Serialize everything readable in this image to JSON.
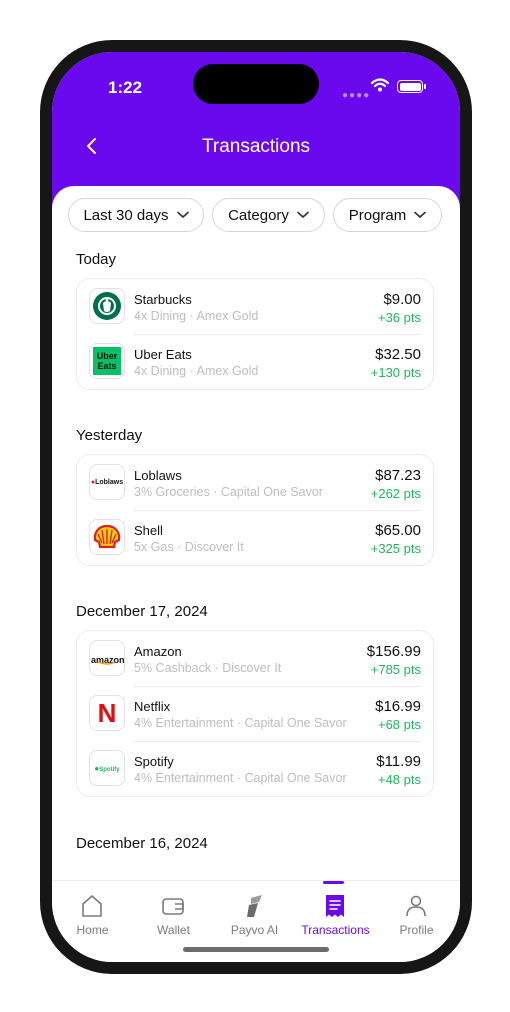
{
  "status_bar": {
    "time": "1:22"
  },
  "header": {
    "title": "Transactions"
  },
  "filters": [
    {
      "label": "Last 30 days"
    },
    {
      "label": "Category"
    },
    {
      "label": "Program"
    }
  ],
  "groups": [
    {
      "title": "Today",
      "items": [
        {
          "merchant": "Starbucks",
          "desc": "4x Dining · Amex Gold",
          "amount": "$9.00",
          "pts": "+36 pts",
          "logo": "starbucks-logo"
        },
        {
          "merchant": "Uber Eats",
          "desc": "4x Dining · Amex Gold",
          "amount": "$32.50",
          "pts": "+130 pts",
          "logo": "uber-eats-logo",
          "logo_text": [
            "Uber",
            "Eats"
          ]
        }
      ]
    },
    {
      "title": "Yesterday",
      "items": [
        {
          "merchant": "Loblaws",
          "desc": "3% Groceries · Capital One Savor",
          "amount": "$87.23",
          "pts": "+262 pts",
          "logo": "loblaws-logo",
          "logo_text": "Loblaws"
        },
        {
          "merchant": "Shell",
          "desc": "5x Gas · Discover It",
          "amount": "$65.00",
          "pts": "+325 pts",
          "logo": "shell-logo"
        }
      ]
    },
    {
      "title": "December 17, 2024",
      "items": [
        {
          "merchant": "Amazon",
          "desc": "5% Cashback · Discover It",
          "amount": "$156.99",
          "pts": "+785 pts",
          "logo": "amazon-logo",
          "logo_text": "amazon"
        },
        {
          "merchant": "Netflix",
          "desc": "4% Entertainment · Capital One Savor",
          "amount": "$16.99",
          "pts": "+68 pts",
          "logo": "netflix-logo",
          "logo_text": "N"
        },
        {
          "merchant": "Spotify",
          "desc": "4% Entertainment · Capital One Savor",
          "amount": "$11.99",
          "pts": "+48 pts",
          "logo": "spotify-logo",
          "logo_text": "Spotify"
        }
      ]
    },
    {
      "title": "December 16, 2024",
      "items": []
    }
  ],
  "tabs": [
    {
      "label": "Home",
      "icon": "home-icon"
    },
    {
      "label": "Wallet",
      "icon": "wallet-icon"
    },
    {
      "label": "Payvo AI",
      "icon": "payvo-ai-icon"
    },
    {
      "label": "Transactions",
      "icon": "receipt-icon",
      "active": true
    },
    {
      "label": "Profile",
      "icon": "profile-icon"
    }
  ],
  "colors": {
    "brand": "#6a08ee",
    "points": "#1fb75b",
    "muted": "#bdbdc2"
  }
}
